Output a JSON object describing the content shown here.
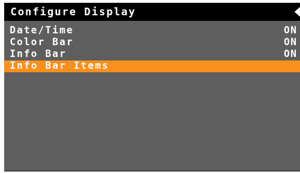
{
  "header": {
    "title": "Configure Display"
  },
  "menu": {
    "items": [
      {
        "label": "Date/Time",
        "value": "ON"
      },
      {
        "label": "Color Bar",
        "value": "ON"
      },
      {
        "label": "Info Bar",
        "value": "ON"
      },
      {
        "label": "Info Bar Items",
        "value": ""
      }
    ],
    "selected_index": 3
  },
  "colors": {
    "background": "#5e5e5e",
    "titlebar": "#000000",
    "highlight": "#f7901e",
    "text": "#ffffff"
  },
  "icons": {
    "title_arrow": "left-arrow-icon"
  }
}
